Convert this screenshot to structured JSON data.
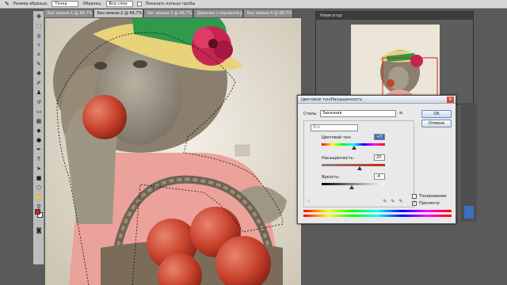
{
  "options_bar": {
    "sample_size_label": "Размер образца:",
    "sample_size_value": "Точка",
    "sample_label": "Образец:",
    "sample_value": "Все слои",
    "show_sample_label": "Показать кольцо пробы"
  },
  "tabs": [
    {
      "label": "Без имени-1 @ 66,7% (Слой 1, ..."
    },
    {
      "label": "Без имени-2 @ 66,7% (Слой 1, RGB/8)"
    },
    {
      "label": "Бег имени-3 @ 66,7% (R..."
    },
    {
      "label": "Девочка с корзиной.jpg ..."
    },
    {
      "label": "Без имени-4 @ 66,7% (R..."
    }
  ],
  "navigator": {
    "title": "Навигатор"
  },
  "dialog": {
    "title": "Цветовой тон/Насыщенность",
    "styles_label": "Стиль:",
    "styles_value": "Заказная",
    "channel_value": "Все",
    "hue_label": "Цветовой тон:",
    "hue_value": "+3",
    "saturation_label": "Насыщенность:",
    "saturation_value": "20",
    "lightness_label": "Яркость:",
    "lightness_value": "-4",
    "ok_label": "OK",
    "cancel_label": "Отмена",
    "colorize_label": "Тонирование",
    "preview_label": "Просмотр",
    "hue_level": 0.51,
    "saturation_level": 0.6,
    "lightness_level": 0.48
  },
  "colors": {
    "foreground": "#c8261c",
    "background": "#ffffff",
    "accent": "#3c6fc1"
  }
}
